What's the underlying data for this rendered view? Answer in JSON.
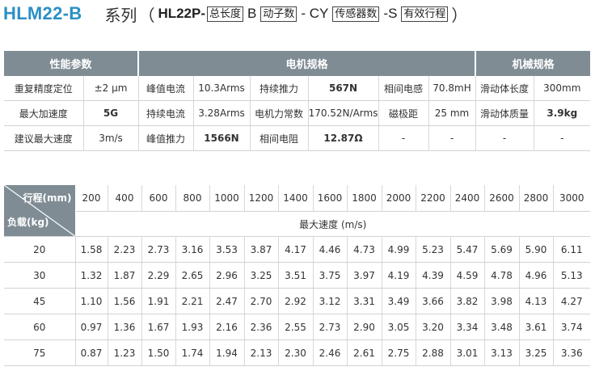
{
  "title": {
    "model": "HLM22-B",
    "series_label": "系列",
    "paren_open": "（",
    "prefix": "HL22P-",
    "box_total_length": "总长度",
    "b": "B",
    "box_mover_count": "动子数",
    "dash_cy": "- CY",
    "box_sensor_count": "传感器数",
    "dash_s": "-S",
    "box_effective_stroke": "有效行程",
    "paren_close": "）"
  },
  "spec_table": {
    "headers": [
      "性能参数",
      "电机规格",
      "机械规格"
    ],
    "rows": [
      [
        "重复精度定位",
        "±2 μm",
        "峰值电流",
        "10.3Arms",
        "持续推力",
        "567N",
        "相间电感",
        "70.8mH",
        "滑动体长度",
        "300mm"
      ],
      [
        "最大加速度",
        "5G",
        "持续电流",
        "3.28Arms",
        "电机力常数",
        "170.52N/Arms",
        "磁极距",
        "25 mm",
        "滑动体质量",
        "3.9kg"
      ],
      [
        "建议最大速度",
        "3m/s",
        "峰值推力",
        "1566N",
        "相间电阻",
        "12.87Ω",
        "-",
        "-",
        "-",
        "-"
      ]
    ]
  },
  "speed_table": {
    "corner_top": "行程(mm)",
    "corner_bottom": "负载(kg)",
    "strokes": [
      "200",
      "400",
      "600",
      "800",
      "1000",
      "1200",
      "1400",
      "1600",
      "1800",
      "2000",
      "2200",
      "2400",
      "2600",
      "2800",
      "3000"
    ],
    "unit_label": "最大速度 (m/s)",
    "rows": [
      {
        "load": "20",
        "values": [
          "1.58",
          "2.23",
          "2.73",
          "3.16",
          "3.53",
          "3.87",
          "4.17",
          "4.46",
          "4.73",
          "4.99",
          "5.23",
          "5.47",
          "5.69",
          "5.90",
          "6.11"
        ]
      },
      {
        "load": "30",
        "values": [
          "1.32",
          "1.87",
          "2.29",
          "2.65",
          "2.96",
          "3.25",
          "3.51",
          "3.75",
          "3.97",
          "4.19",
          "4.39",
          "4.59",
          "4.78",
          "4.96",
          "5.13"
        ]
      },
      {
        "load": "45",
        "values": [
          "1.10",
          "1.56",
          "1.91",
          "2.21",
          "2.47",
          "2.70",
          "2.92",
          "3.12",
          "3.31",
          "3.49",
          "3.66",
          "3.82",
          "3.98",
          "4.13",
          "4.27"
        ]
      },
      {
        "load": "60",
        "values": [
          "0.97",
          "1.36",
          "1.67",
          "1.93",
          "2.16",
          "2.36",
          "2.55",
          "2.73",
          "2.90",
          "3.05",
          "3.20",
          "3.34",
          "3.48",
          "3.61",
          "3.74"
        ]
      },
      {
        "load": "75",
        "values": [
          "0.87",
          "1.23",
          "1.50",
          "1.74",
          "1.94",
          "2.13",
          "2.30",
          "2.46",
          "2.61",
          "2.75",
          "2.88",
          "3.01",
          "3.13",
          "3.25",
          "3.36"
        ]
      }
    ]
  }
}
